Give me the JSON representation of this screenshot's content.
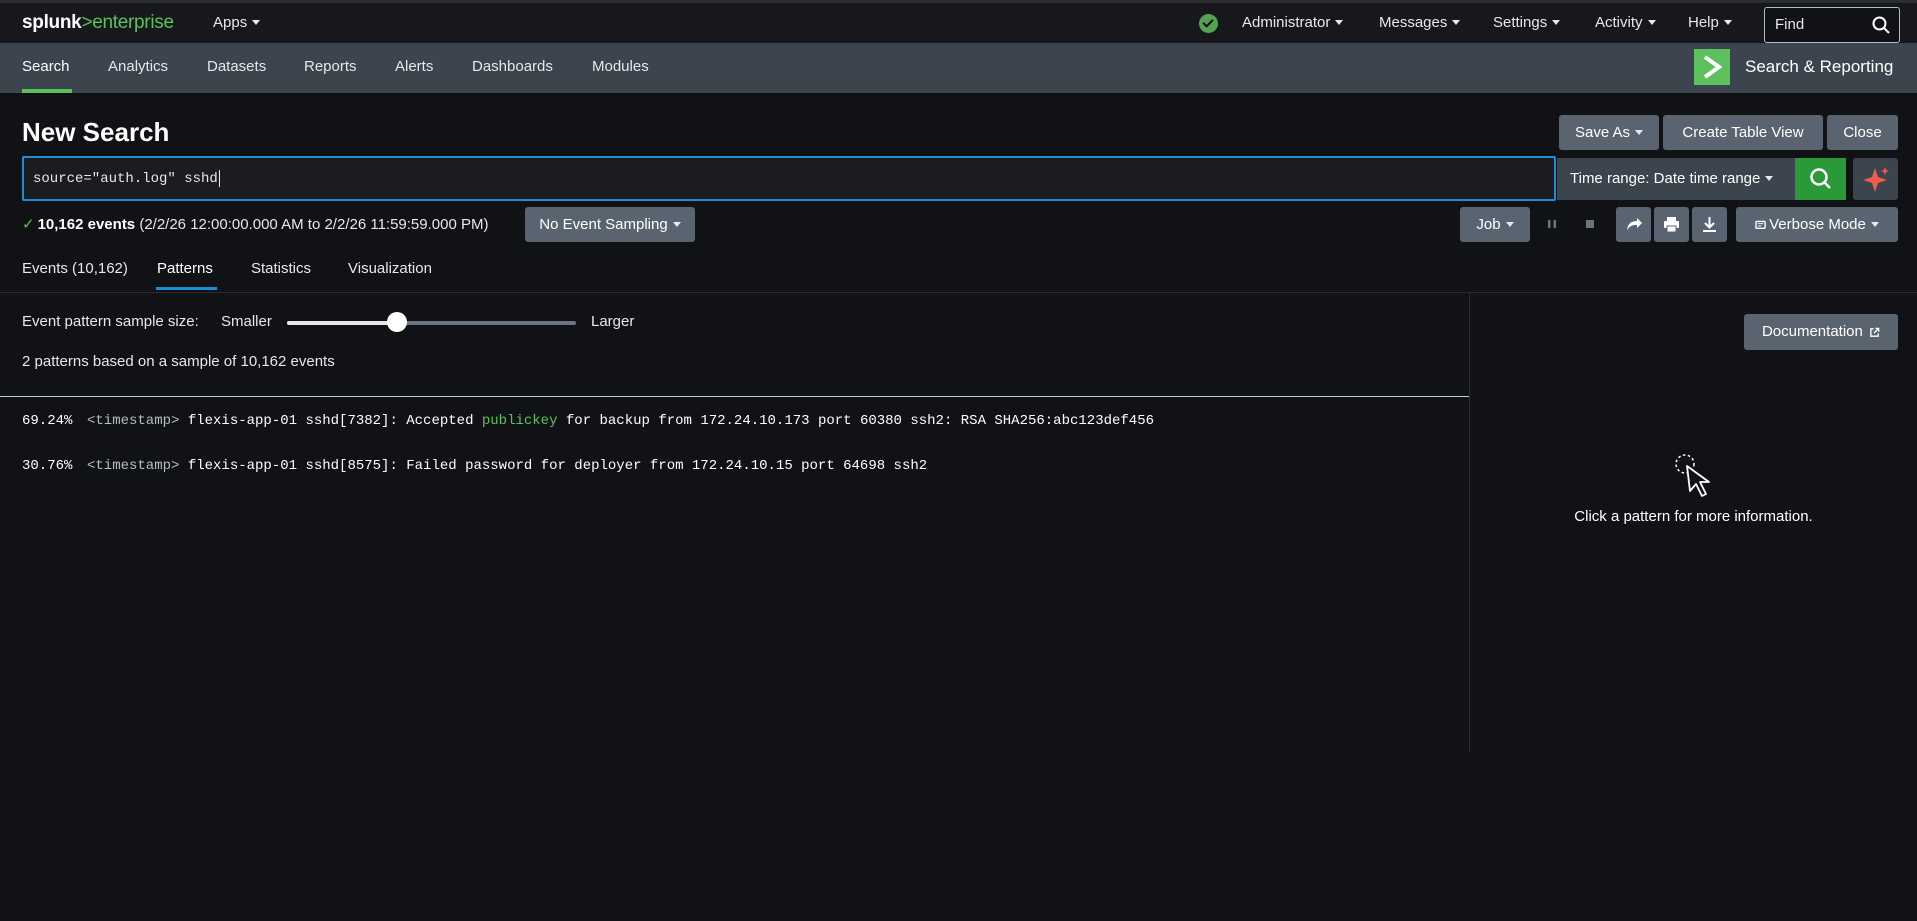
{
  "brand": {
    "logo_main": "splunk",
    "logo_accent": ">enterprise"
  },
  "topbar": {
    "apps_label": "Apps",
    "menu": [
      {
        "label": "Administrator"
      },
      {
        "label": "Messages"
      },
      {
        "label": "Settings"
      },
      {
        "label": "Activity"
      },
      {
        "label": "Help"
      }
    ],
    "find_placeholder": "Find",
    "status_color": "#55a154"
  },
  "appbar": {
    "tabs": [
      {
        "label": "Search"
      },
      {
        "label": "Analytics"
      },
      {
        "label": "Datasets"
      },
      {
        "label": "Reports"
      },
      {
        "label": "Alerts"
      },
      {
        "label": "Dashboards"
      },
      {
        "label": "Modules"
      }
    ],
    "active_tab": "Search",
    "app_name": "Search & Reporting",
    "accent_color": "#5cc05c"
  },
  "page": {
    "title": "New Search",
    "actions": {
      "save_as": "Save As",
      "create_table_view": "Create Table View",
      "close": "Close"
    }
  },
  "search": {
    "query": "source=\"auth.log\" sshd",
    "time_range": "Time range: Date time range"
  },
  "job": {
    "event_count": "10,162 events",
    "range_text": "(2/2/26 12:00:00.000 AM to 2/2/26 11:59:59.000 PM)",
    "sampling": "No Event Sampling",
    "job_label": "Job",
    "mode_label": "Verbose Mode"
  },
  "results_tabs": [
    {
      "label": "Events (10,162)"
    },
    {
      "label": "Patterns"
    },
    {
      "label": "Statistics"
    },
    {
      "label": "Visualization"
    }
  ],
  "active_results_tab": "Patterns",
  "patterns": {
    "sample_label": "Event pattern sample size:",
    "smaller": "Smaller",
    "larger": "Larger",
    "slider_level_fraction": 0.38,
    "summary": "2 patterns based on a sample of 10,162 events",
    "rows": [
      {
        "percent": "69.24%",
        "timestamp": "<timestamp>",
        "text_before": " flexis-app-01 sshd[7382]: Accepted ",
        "keyword": "publickey",
        "text_after": " for backup from 172.24.10.173 port 60380 ssh2: RSA SHA256:abc123def456"
      },
      {
        "percent": "30.76%",
        "timestamp": "<timestamp>",
        "text_before": " flexis-app-01 sshd[8575]: Failed password for deployer from 172.24.10.15 port 64698 ssh2",
        "keyword": "",
        "text_after": ""
      }
    ]
  },
  "side_panel": {
    "doc_label": "Documentation",
    "hint": "Click a pattern for more information."
  }
}
